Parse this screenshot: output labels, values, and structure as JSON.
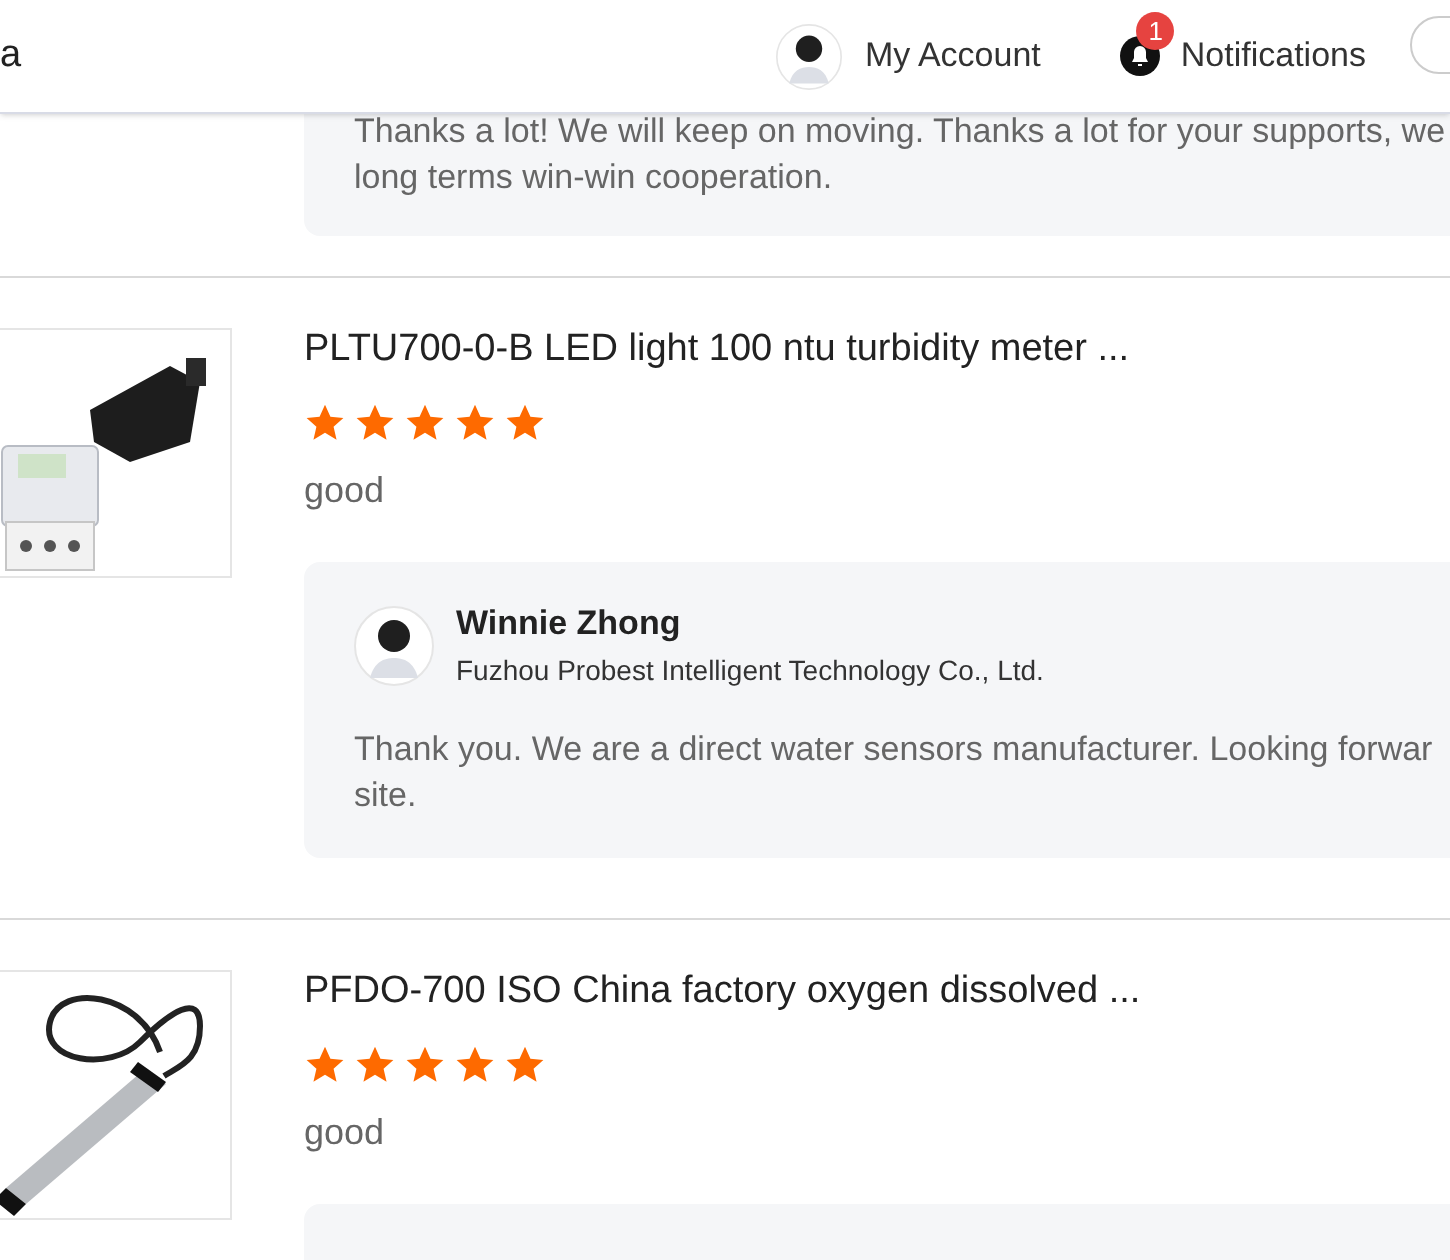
{
  "header": {
    "logo_text": "a",
    "account": {
      "label": "My Account"
    },
    "notifications": {
      "label": "Notifications",
      "count": "1"
    }
  },
  "reviews": [
    {
      "reply": {
        "lines": [
          "Thanks a lot! We will keep on moving. Thanks a lot for your supports, we",
          "long terms win-win cooperation."
        ]
      }
    },
    {
      "product": "PLTU700-0-B LED light 100 ntu turbidity meter ...",
      "stars": 5,
      "comment": "good",
      "reply": {
        "name": "Winnie Zhong",
        "company": "Fuzhou Probest Intelligent Technology Co., Ltd.",
        "lines": [
          "Thank you. We are a direct water sensors manufacturer. Looking forwar",
          "site."
        ]
      }
    },
    {
      "product": "PFDO-700 ISO China factory oxygen dissolved ...",
      "stars": 5,
      "comment": "good"
    }
  ]
}
